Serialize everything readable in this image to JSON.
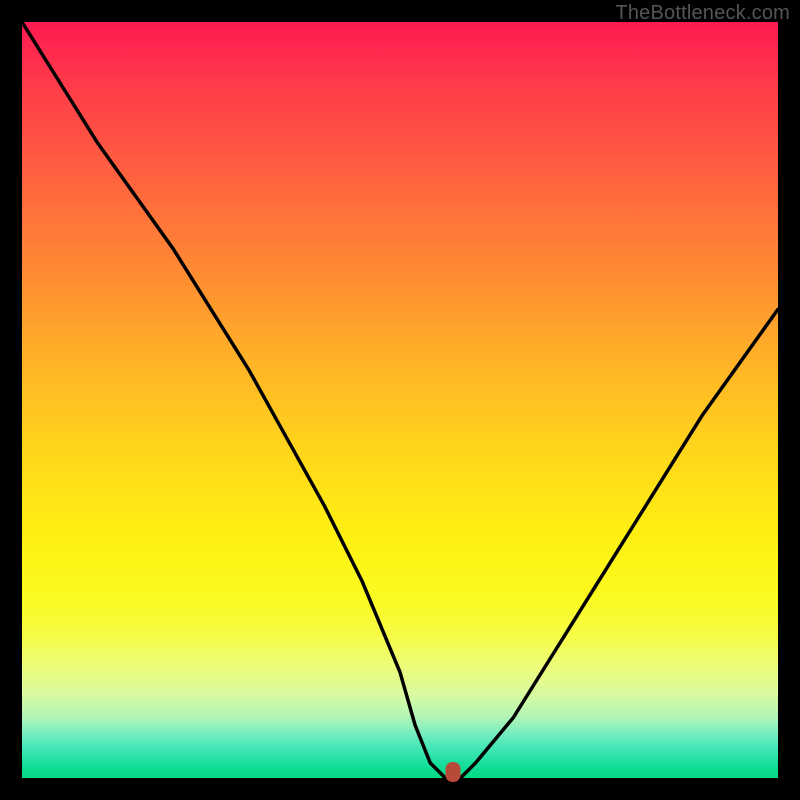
{
  "watermark": "TheBottleneck.com",
  "colors": {
    "frame": "#000000",
    "curve": "#000000",
    "marker": "#b84a3a"
  },
  "chart_data": {
    "type": "line",
    "title": "",
    "xlabel": "",
    "ylabel": "",
    "xlim": [
      0,
      100
    ],
    "ylim": [
      0,
      100
    ],
    "grid": false,
    "series": [
      {
        "name": "bottleneck-curve",
        "x": [
          0,
          5,
          10,
          15,
          20,
          25,
          30,
          35,
          40,
          45,
          50,
          52,
          54,
          56,
          58,
          60,
          65,
          70,
          75,
          80,
          85,
          90,
          95,
          100
        ],
        "values": [
          100,
          92,
          84,
          77,
          70,
          62,
          54,
          45,
          36,
          26,
          14,
          7,
          2,
          0,
          0,
          2,
          8,
          16,
          24,
          32,
          40,
          48,
          55,
          62
        ]
      }
    ],
    "marker": {
      "x": 57,
      "y": 0
    }
  }
}
